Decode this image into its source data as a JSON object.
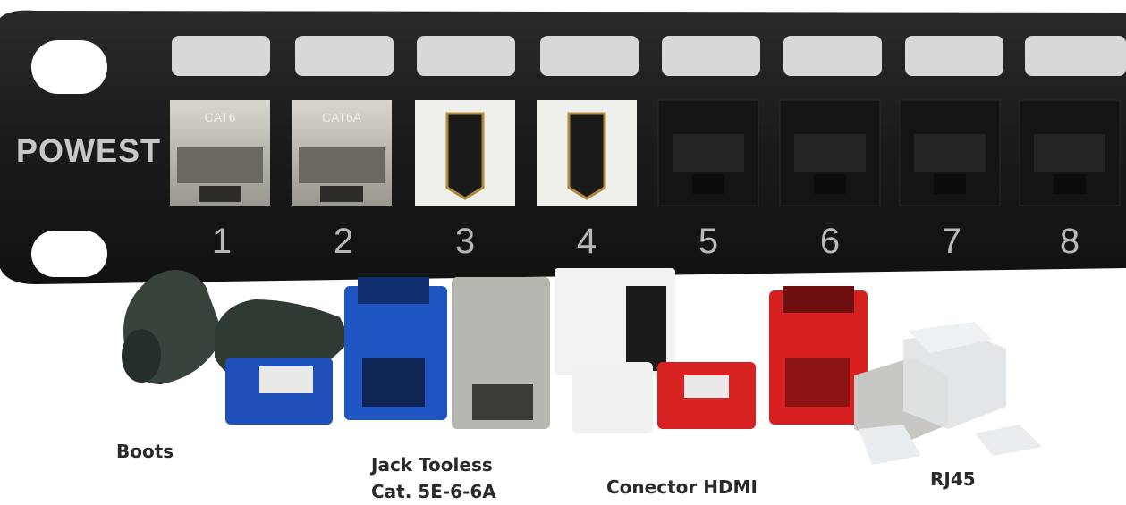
{
  "panel": {
    "brand": "POWEST",
    "ports": [
      {
        "number": "1",
        "type": "CAT6"
      },
      {
        "number": "2",
        "type": "CAT6A"
      },
      {
        "number": "3",
        "type": "HDMI"
      },
      {
        "number": "4",
        "type": "HDMI"
      },
      {
        "number": "5",
        "type": ""
      },
      {
        "number": "6",
        "type": ""
      },
      {
        "number": "7",
        "type": ""
      },
      {
        "number": "8",
        "type": ""
      }
    ]
  },
  "captions": {
    "boots": "Boots",
    "jack_line1": "Jack Tooless",
    "jack_line2": "Cat. 5E-6-6A",
    "hdmi": "Conector HDMI",
    "rj45": "RJ45"
  },
  "colors": {
    "panel": "#1c1c1c",
    "boot": "#2f3a33",
    "jack_blue": "#1f56c4",
    "jack_red": "#d81f1f",
    "metal": "#b8b6b0"
  }
}
